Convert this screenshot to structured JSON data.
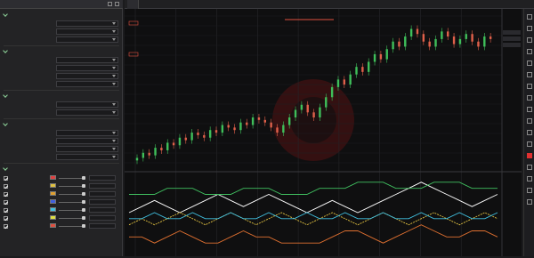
{
  "panel": {
    "title": "",
    "sections": [
      {
        "title": "",
        "rows": [
          {
            "label": "",
            "value": ""
          },
          {
            "label": "",
            "value": ""
          },
          {
            "label": "",
            "value": ""
          }
        ]
      },
      {
        "title": "",
        "rows": [
          {
            "label": "",
            "value": ""
          },
          {
            "label": "",
            "value": ""
          },
          {
            "label": "",
            "value": ""
          },
          {
            "label": "",
            "value": ""
          }
        ]
      },
      {
        "title": "",
        "rows": [
          {
            "label": "",
            "value": ""
          },
          {
            "label": "",
            "value": ""
          }
        ]
      },
      {
        "title": "",
        "rows": [
          {
            "label": "",
            "value": ""
          },
          {
            "label": "",
            "value": ""
          },
          {
            "label": "",
            "value": ""
          },
          {
            "label": "",
            "value": ""
          }
        ]
      }
    ],
    "plots_title": "",
    "plots": [
      {
        "label": "",
        "color": "#e04040"
      },
      {
        "label": "",
        "color": "#e0c040"
      },
      {
        "label": "",
        "color": "#e0a030"
      },
      {
        "label": "",
        "color": "#4060e0"
      },
      {
        "label": "",
        "color": "#40c0e0"
      },
      {
        "label": "",
        "color": "#e0e040"
      },
      {
        "label": "",
        "color": "#e05040"
      }
    ]
  },
  "chart": {
    "tab_label": "",
    "title": "",
    "price_badge_left": "",
    "price_tags_right": [
      "",
      "",
      ""
    ]
  },
  "chart_data": {
    "type": "line",
    "title": "",
    "candles": [
      14,
      16,
      15,
      18,
      17,
      20,
      19,
      22,
      21,
      24,
      23,
      22,
      25,
      24,
      27,
      26,
      25,
      28,
      27,
      30,
      29,
      28,
      26,
      24,
      27,
      30,
      33,
      35,
      32,
      30,
      34,
      38,
      42,
      45,
      43,
      47,
      50,
      48,
      52,
      55,
      53,
      57,
      60,
      58,
      62,
      65,
      63,
      60,
      58,
      61,
      64,
      62,
      59,
      61,
      63,
      60,
      58,
      62,
      61
    ],
    "subseries": [
      {
        "color": "#ffffff",
        "values": [
          6,
          7,
          8,
          7,
          6,
          7,
          8,
          9,
          8,
          7,
          8,
          9,
          8,
          7,
          6,
          7,
          8,
          7,
          6,
          7,
          8,
          9,
          10,
          11,
          10,
          9,
          8,
          7,
          8,
          9
        ]
      },
      {
        "color": "#e0c040",
        "values": [
          4,
          5,
          4,
          5,
          6,
          5,
          4,
          5,
          6,
          5,
          4,
          5,
          6,
          5,
          4,
          5,
          6,
          5,
          4,
          5,
          6,
          5,
          4,
          5,
          6,
          5,
          4,
          5,
          6,
          5
        ]
      },
      {
        "color": "#40c0e0",
        "values": [
          5,
          5,
          6,
          5,
          5,
          6,
          5,
          5,
          6,
          5,
          5,
          6,
          5,
          5,
          6,
          5,
          5,
          6,
          5,
          5,
          6,
          5,
          5,
          6,
          5,
          5,
          6,
          5,
          5,
          6
        ]
      },
      {
        "color": "#e07030",
        "values": [
          2,
          2,
          1,
          2,
          3,
          2,
          1,
          1,
          2,
          3,
          2,
          2,
          1,
          1,
          1,
          1,
          2,
          3,
          3,
          2,
          1,
          2,
          3,
          4,
          3,
          2,
          2,
          3,
          3,
          2
        ]
      },
      {
        "color": "#40c060",
        "values": [
          9,
          9,
          9,
          10,
          10,
          10,
          9,
          9,
          9,
          10,
          10,
          10,
          9,
          9,
          9,
          10,
          10,
          10,
          11,
          11,
          11,
          10,
          10,
          10,
          11,
          11,
          11,
          10,
          10,
          10
        ]
      }
    ]
  }
}
